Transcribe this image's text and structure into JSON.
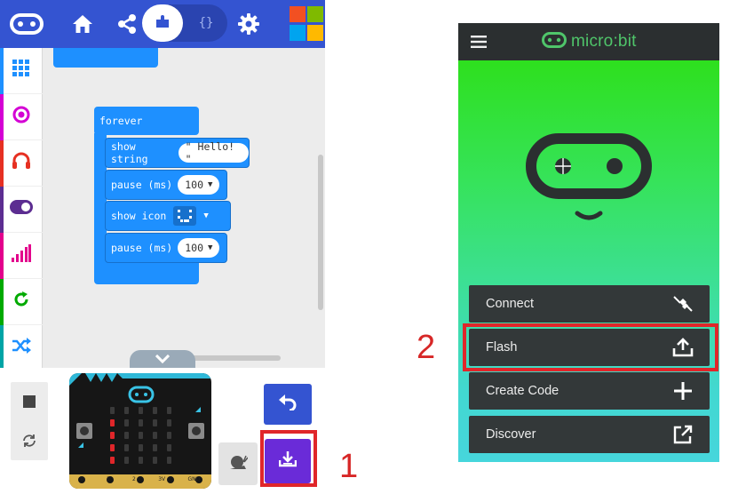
{
  "editor": {
    "topbar": {
      "logo_icon": "microbit-logo-icon",
      "home_icon": "home-icon",
      "share_icon": "share-icon",
      "blocks_icon": "puzzle-icon",
      "js_label": "{}",
      "settings_icon": "gear-icon",
      "brand_logo": "microsoft-logo",
      "colors": {
        "bar": "#3454d1",
        "ms_red": "#f25022",
        "ms_green": "#7fba00",
        "ms_blue": "#00a4ef",
        "ms_yellow": "#ffb900"
      }
    },
    "toolbox": [
      {
        "name": "basic",
        "icon": "grid-icon",
        "color": "#1e90ff"
      },
      {
        "name": "input",
        "icon": "target-icon",
        "color": "#d400d4"
      },
      {
        "name": "music",
        "icon": "headphones-icon",
        "color": "#e63022"
      },
      {
        "name": "led",
        "icon": "toggle-icon",
        "color": "#5c2d91"
      },
      {
        "name": "radio",
        "icon": "signal-icon",
        "color": "#e3008c"
      },
      {
        "name": "loops",
        "icon": "refresh-icon",
        "color": "#00aa00"
      },
      {
        "name": "logic",
        "icon": "shuffle-icon",
        "color": "#00a4a6"
      }
    ],
    "blocks": {
      "forever_label": "forever",
      "show_string_label": "show string",
      "show_string_value": "\" Hello! \"",
      "pause1_label": "pause (ms)",
      "pause1_value": "100",
      "show_icon_label": "show icon",
      "pause2_label": "pause (ms)",
      "pause2_value": "100"
    },
    "simulator": {
      "stop_icon": "stop-icon",
      "restart_icon": "restart-icon",
      "undo_icon": "undo-icon",
      "slow_icon": "snail-icon",
      "download_icon": "download-icon",
      "pins": [
        "0",
        "1",
        "2",
        "3V",
        "GND"
      ],
      "led_color": "#e0262a"
    }
  },
  "annotations": {
    "step1": "1",
    "step2": "2",
    "highlight_color": "#e0262a"
  },
  "app": {
    "brand": "micro:bit",
    "menu_icon": "hamburger-icon",
    "mascot": "microbit-face",
    "rows": [
      {
        "label": "Connect",
        "icon": "plug-icon"
      },
      {
        "label": "Flash",
        "icon": "upload-icon"
      },
      {
        "label": "Create Code",
        "icon": "plus-icon"
      },
      {
        "label": "Discover",
        "icon": "external-link-icon"
      }
    ]
  }
}
